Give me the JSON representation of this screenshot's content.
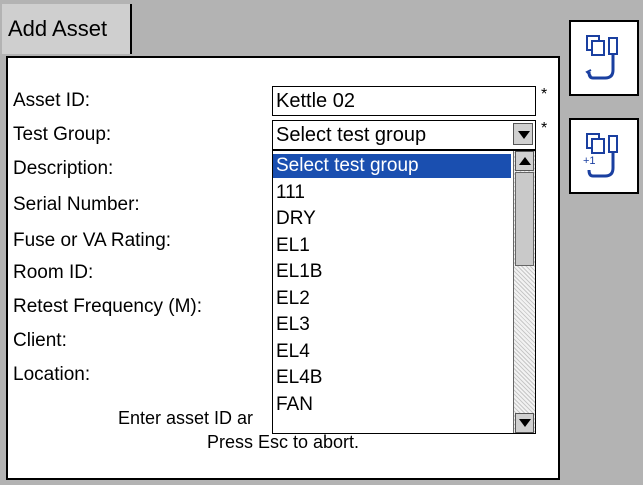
{
  "tab": {
    "title": "Add Asset"
  },
  "form": {
    "asset_id": {
      "label": "Asset ID:",
      "value": "Kettle 02",
      "required": "*"
    },
    "test_group": {
      "label": "Test Group:",
      "value": "Select test group",
      "required": "*"
    },
    "description": {
      "label": "Description:"
    },
    "serial_number": {
      "label": "Serial Number:"
    },
    "fuse_rating": {
      "label": "Fuse or VA Rating:"
    },
    "room_id": {
      "label": "Room ID:"
    },
    "retest_frequency": {
      "label": "Retest Frequency (M):"
    },
    "client": {
      "label": "Client:"
    },
    "location": {
      "label": "Location:"
    }
  },
  "dropdown": {
    "items": [
      "Select test group",
      "111",
      "DRY",
      "EL1",
      "EL1B",
      "EL2",
      "EL3",
      "EL4",
      "EL4B",
      "FAN"
    ],
    "selected_index": 0
  },
  "instructions": {
    "line1": "Enter asset ID ar",
    "line2": "Press Esc to abort."
  },
  "side_buttons": [
    {
      "icon": "copy-asset-icon"
    },
    {
      "icon": "copy-asset-increment-icon"
    }
  ],
  "colors": {
    "selection": "#1a4fb0",
    "background": "#b3b3b3"
  }
}
